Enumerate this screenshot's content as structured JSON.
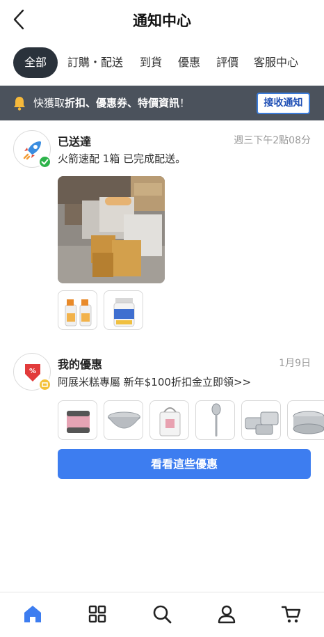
{
  "header": {
    "title": "通知中心"
  },
  "tabs": [
    {
      "label": "全部",
      "active": true
    },
    {
      "label": "訂購・配送",
      "active": false
    },
    {
      "label": "到貨",
      "active": false
    },
    {
      "label": "優惠",
      "active": false
    },
    {
      "label": "評價",
      "active": false
    },
    {
      "label": "客服中心",
      "active": false
    }
  ],
  "banner": {
    "text_prefix": "快獲取",
    "text_emphasis": "折扣、優惠券、特價資訊",
    "text_suffix": "！",
    "button_label": "接收通知"
  },
  "notifications": [
    {
      "title": "已送達",
      "time": "週三下午2點08分",
      "body": "火箭速配 1箱 已完成配送。",
      "avatar_icon": "rocket-icon",
      "badge_icon": "check-icon"
    },
    {
      "title": "我的優惠",
      "time": "1月9日",
      "body": "阿展米糕專屬 新年$100折扣金立即領>>",
      "avatar_icon": "discount-tag-icon",
      "badge_icon": "coupon-icon",
      "cta_label": "看看這些優惠"
    }
  ],
  "bottom_nav": [
    {
      "icon": "home-icon",
      "active": true
    },
    {
      "icon": "grid-icon",
      "active": false
    },
    {
      "icon": "search-icon",
      "active": false
    },
    {
      "icon": "user-icon",
      "active": false
    },
    {
      "icon": "cart-icon",
      "active": false
    }
  ],
  "colors": {
    "accent": "#3d7df0",
    "banner_bg": "#4b525c",
    "active_tab_bg": "#2a323b",
    "success": "#2cb34a",
    "coupon": "#f4c23a"
  }
}
